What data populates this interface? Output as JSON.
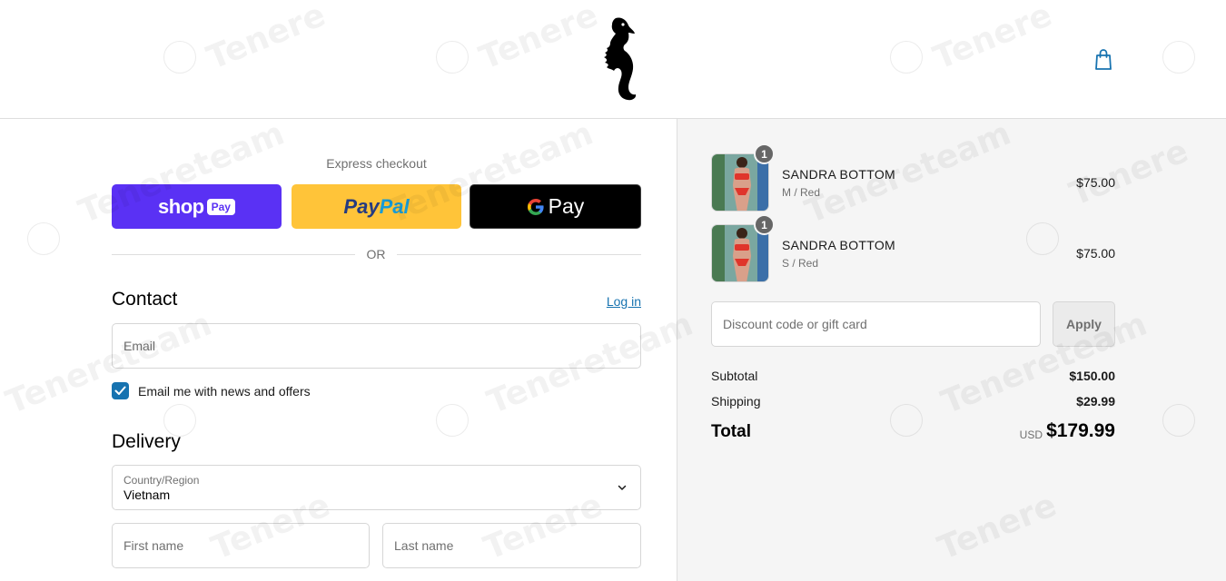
{
  "header": {
    "logo_icon": "seahorse-logo",
    "cart_icon": "shopping-bag-icon",
    "accent_color": "#1773b0"
  },
  "express": {
    "title": "Express checkout",
    "shop_pay": {
      "word": "shop",
      "badge": "Pay"
    },
    "paypal": {
      "part1": "Pay",
      "part2": "Pal"
    },
    "gpay": {
      "letter": "G",
      "word": "Pay"
    },
    "or_label": "OR"
  },
  "contact": {
    "title": "Contact",
    "login_label": "Log in",
    "email_placeholder": "Email",
    "newsletter_label": "Email me with news and offers",
    "newsletter_checked": true
  },
  "delivery": {
    "title": "Delivery",
    "country_label": "Country/Region",
    "country_value": "Vietnam",
    "first_name_placeholder": "First name",
    "last_name_placeholder": "Last name"
  },
  "order": {
    "items": [
      {
        "quantity": "1",
        "name": "SANDRA BOTTOM",
        "variant": "M / Red",
        "price": "$75.00"
      },
      {
        "quantity": "1",
        "name": "SANDRA BOTTOM",
        "variant": "S / Red",
        "price": "$75.00"
      }
    ],
    "discount_placeholder": "Discount code or gift card",
    "apply_label": "Apply",
    "subtotal_label": "Subtotal",
    "subtotal_value": "$150.00",
    "shipping_label": "Shipping",
    "shipping_value": "$29.99",
    "total_label": "Total",
    "currency": "USD",
    "total_value": "$179.99"
  },
  "watermark": {
    "text": "Tenereteam"
  }
}
